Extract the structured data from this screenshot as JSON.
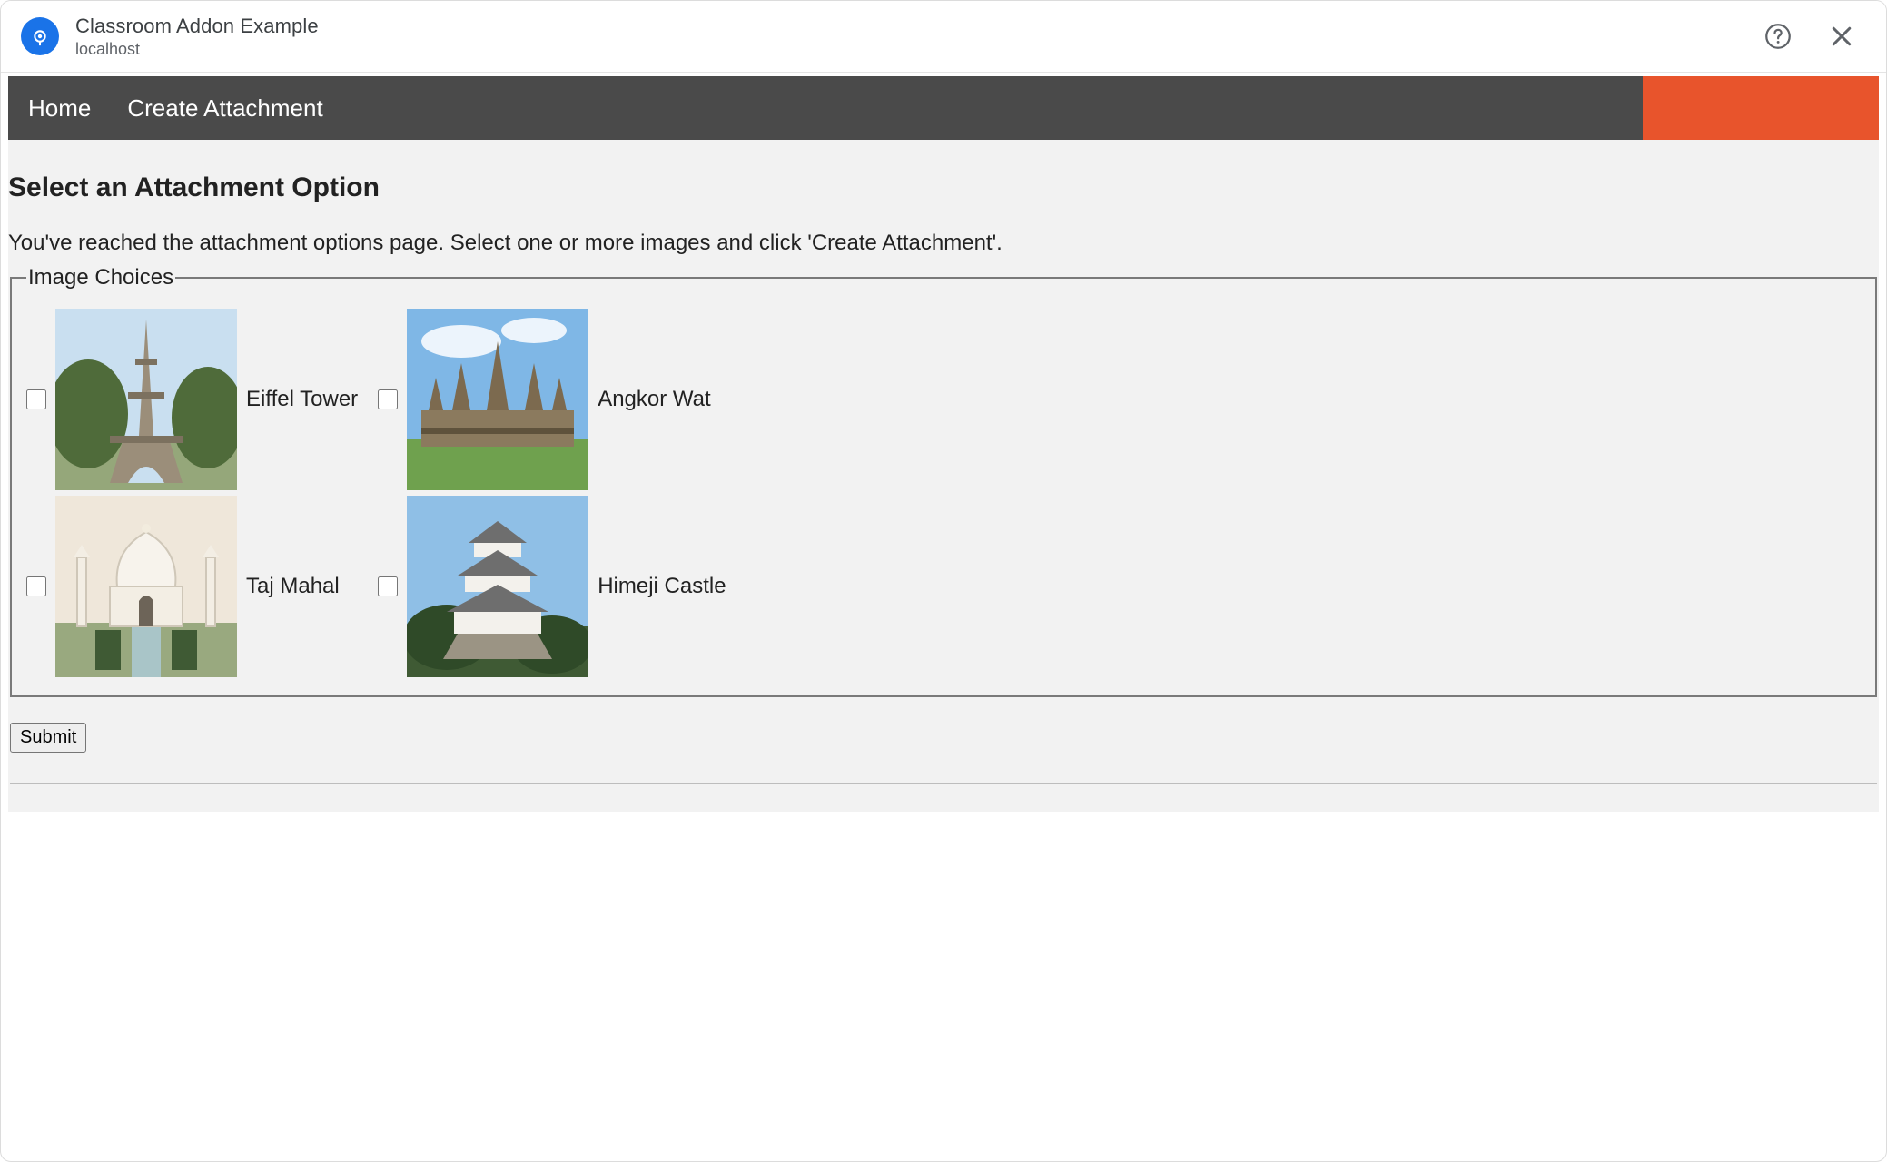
{
  "dialog": {
    "title": "Classroom Addon Example",
    "subtitle": "localhost"
  },
  "nav": {
    "items": [
      {
        "label": "Home"
      },
      {
        "label": "Create Attachment"
      }
    ]
  },
  "page": {
    "heading": "Select an Attachment Option",
    "instructions": "You've reached the attachment options page. Select one or more images and click 'Create Attachment'.",
    "fieldset_legend": "Image Choices",
    "choices": [
      {
        "label": "Eiffel Tower",
        "checked": false,
        "icon": "eiffel-tower-image"
      },
      {
        "label": "Angkor Wat",
        "checked": false,
        "icon": "angkor-wat-image"
      },
      {
        "label": "Taj Mahal",
        "checked": false,
        "icon": "taj-mahal-image"
      },
      {
        "label": "Himeji Castle",
        "checked": false,
        "icon": "himeji-castle-image"
      }
    ],
    "submit_label": "Submit"
  }
}
